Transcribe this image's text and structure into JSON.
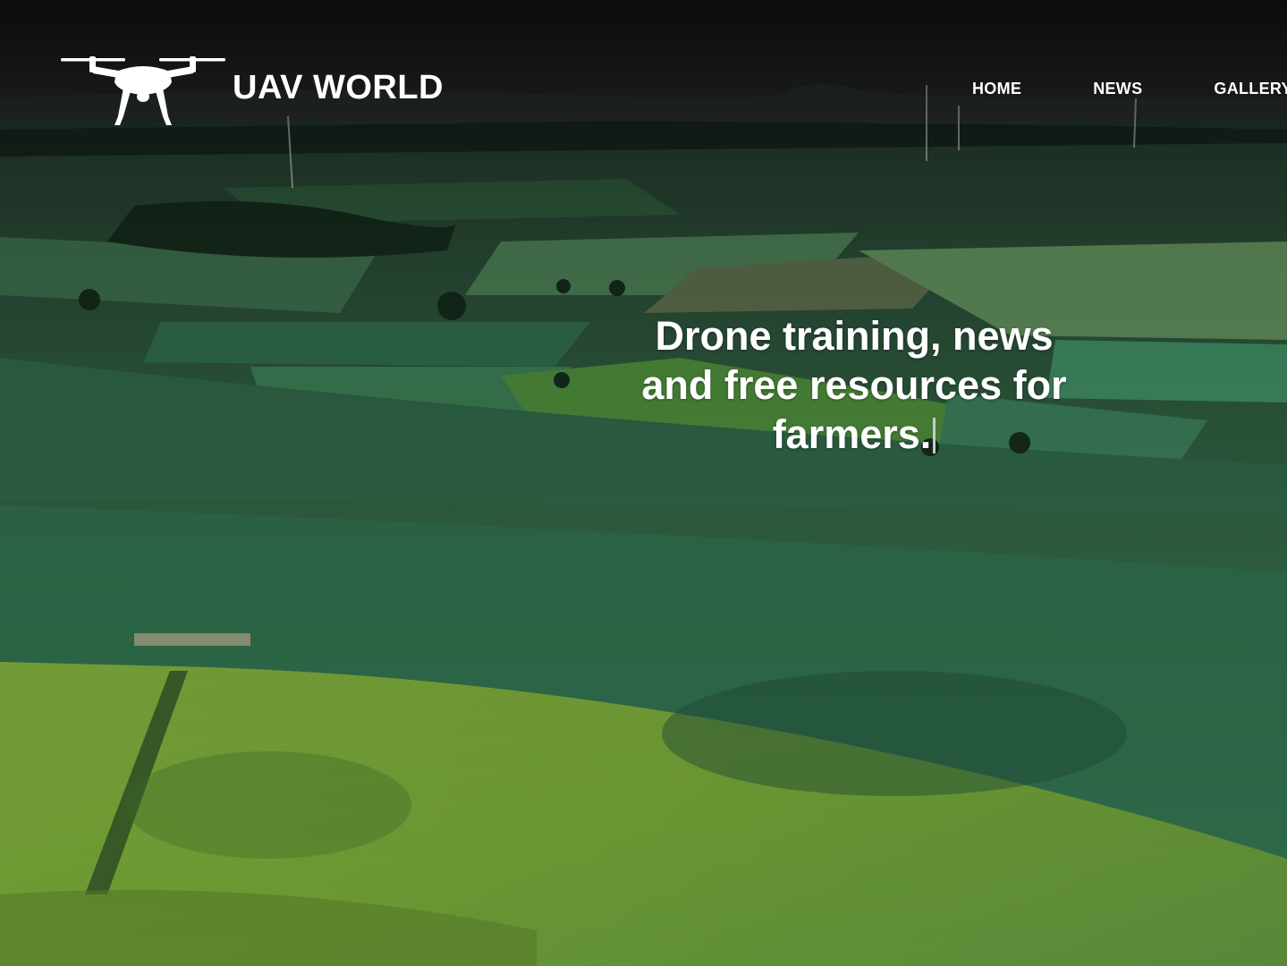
{
  "brand": {
    "logo_icon": "drone-icon",
    "name": "UAV WORLD"
  },
  "nav": {
    "items": [
      {
        "label": "HOME"
      },
      {
        "label": "NEWS"
      },
      {
        "label": "GALLERY"
      }
    ]
  },
  "hero": {
    "tagline_lines": [
      "Drone training, news",
      "and free resources for",
      "farmers."
    ],
    "background_description_colors": {
      "sky": "#1c1c1c",
      "field_dark": "#2c5a3f",
      "field_mid": "#3a7048",
      "field_bright": "#6a9a32",
      "text": "#ffffff"
    }
  }
}
